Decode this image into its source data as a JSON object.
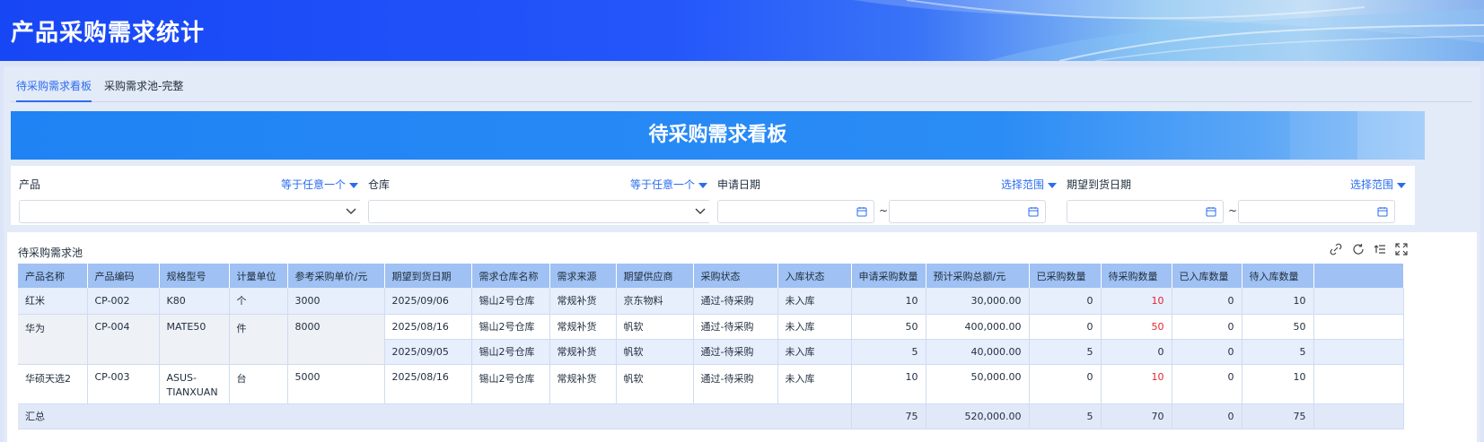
{
  "header": {
    "title": "产品采购需求统计"
  },
  "tabs": [
    {
      "label": "待采购需求看板",
      "active": true
    },
    {
      "label": "采购需求池-完整",
      "active": false
    }
  ],
  "banner": {
    "title": "待采购需求看板"
  },
  "filters": [
    {
      "label": "产品",
      "operator": "等于任意一个",
      "value": ""
    },
    {
      "label": "仓库",
      "operator": "等于任意一个",
      "value": ""
    },
    {
      "label": "申请日期",
      "operator": "选择范围",
      "start": "",
      "end": "",
      "separator": "~"
    },
    {
      "label": "期望到货日期",
      "operator": "选择范围",
      "start": "",
      "end": "",
      "separator": "~"
    }
  ],
  "grid": {
    "title": "待采购需求池",
    "columns": [
      "产品名称",
      "产品编码",
      "规格型号",
      "计量单位",
      "参考采购单价/元",
      "期望到货日期",
      "需求仓库名称",
      "需求来源",
      "期望供应商",
      "采购状态",
      "入库状态",
      "申请采购数量",
      "预计采购总额/元",
      "已采购数量",
      "待采购数量",
      "已入库数量",
      "待入库数量"
    ],
    "rows": [
      {
        "name": "红米",
        "code": "CP-002",
        "spec": "K80",
        "unit": "个",
        "price": "3000",
        "expected_date": "2025/09/06",
        "warehouse": "锡山2号仓库",
        "source": "常规补货",
        "supplier": "京东物料",
        "purchase_status": "通过-待采购",
        "stock_status": "未入库",
        "apply_qty": "10",
        "total": "30,000.00",
        "purchased": "0",
        "pending": "10",
        "stocked": "0",
        "pending_stock": "10"
      },
      {
        "name": "华为",
        "code": "CP-004",
        "spec": "MATE50",
        "unit": "件",
        "price": "8000",
        "expected_date": "2025/08/16",
        "warehouse": "锡山2号仓库",
        "source": "常规补货",
        "supplier": "帆软",
        "purchase_status": "通过-待采购",
        "stock_status": "未入库",
        "apply_qty": "50",
        "total": "400,000.00",
        "purchased": "0",
        "pending": "50",
        "stocked": "0",
        "pending_stock": "50"
      },
      {
        "name": "",
        "code": "",
        "spec": "",
        "unit": "",
        "price": "",
        "expected_date": "2025/09/05",
        "warehouse": "锡山2号仓库",
        "source": "常规补货",
        "supplier": "帆软",
        "purchase_status": "通过-待采购",
        "stock_status": "未入库",
        "apply_qty": "5",
        "total": "40,000.00",
        "purchased": "5",
        "pending": "0",
        "stocked": "0",
        "pending_stock": "5"
      },
      {
        "name": "华硕天选2",
        "code": "CP-003",
        "spec": "ASUS-TIANXUAN",
        "unit": "台",
        "price": "5000",
        "expected_date": "2025/08/16",
        "warehouse": "锡山2号仓库",
        "source": "常规补货",
        "supplier": "帆软",
        "purchase_status": "通过-待采购",
        "stock_status": "未入库",
        "apply_qty": "10",
        "total": "50,000.00",
        "purchased": "0",
        "pending": "10",
        "stocked": "0",
        "pending_stock": "10"
      }
    ],
    "summary": {
      "label": "汇总",
      "apply_qty": "75",
      "total": "520,000.00",
      "purchased": "5",
      "pending": "70",
      "stocked": "0",
      "pending_stock": "75"
    }
  },
  "colors": {
    "accent": "#2a6cf0",
    "header_bg": "#1746f5",
    "banner_bg": "#1f83f4",
    "table_header": "#9fc1f3",
    "warning_text": "#e4252f"
  },
  "icons": [
    "unlink-icon",
    "refresh-icon",
    "collapse-icon",
    "fullscreen-icon",
    "chevron-down-icon",
    "calendar-icon"
  ]
}
